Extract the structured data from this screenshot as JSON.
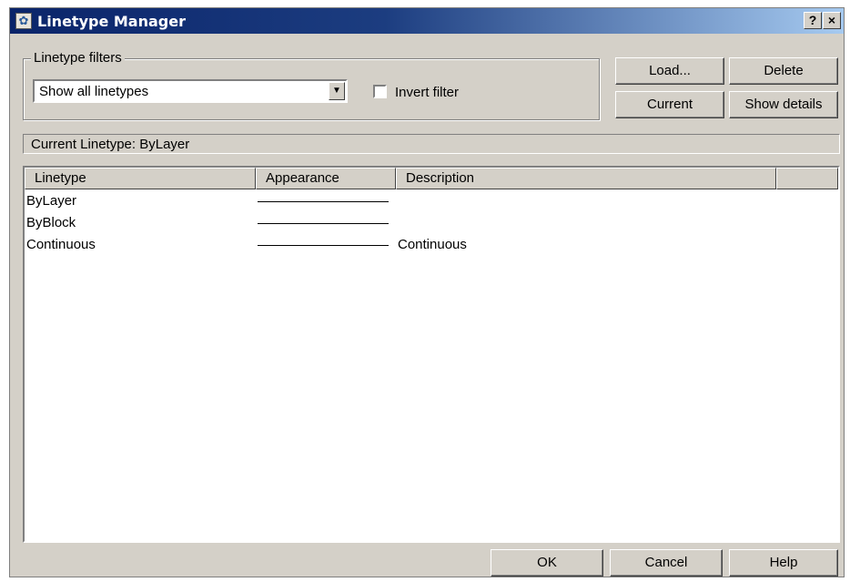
{
  "window": {
    "title": "Linetype Manager",
    "help_btn": "?",
    "close_btn": "×"
  },
  "filters": {
    "group_label": "Linetype filters",
    "selected": "Show all linetypes",
    "invert_label": "Invert filter",
    "invert_checked": false
  },
  "buttons": {
    "load": "Load...",
    "delete": "Delete",
    "current": "Current",
    "show_details": "Show details"
  },
  "current_linetype": "Current Linetype:  ByLayer",
  "table": {
    "columns": [
      "Linetype",
      "Appearance",
      "Description"
    ],
    "rows": [
      {
        "name": "ByLayer",
        "description": ""
      },
      {
        "name": "ByBlock",
        "description": ""
      },
      {
        "name": "Continuous",
        "description": "Continuous"
      }
    ]
  },
  "footer": {
    "ok": "OK",
    "cancel": "Cancel",
    "help": "Help"
  }
}
